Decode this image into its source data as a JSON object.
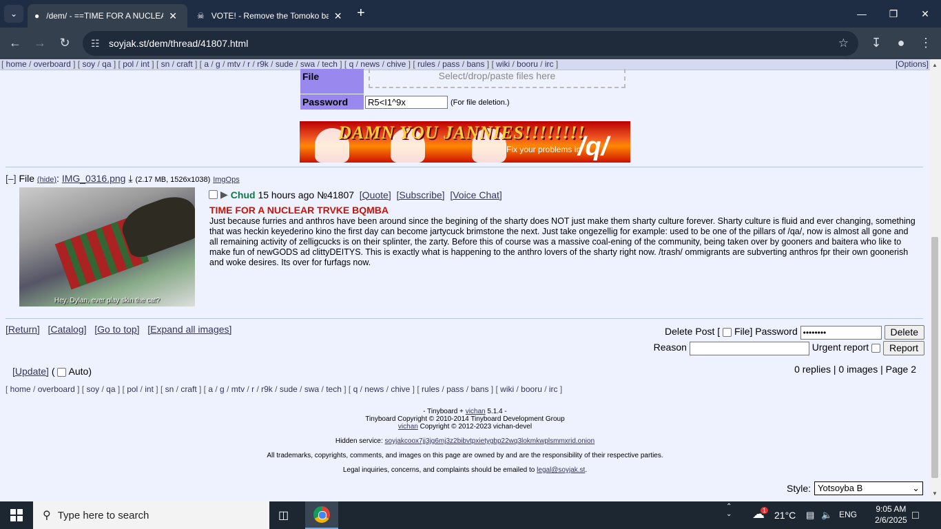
{
  "browser": {
    "tabs": [
      {
        "title": "/dem/ - ==TIME FOR A NUCLEAR TRVKE BQMBA",
        "active": true
      },
      {
        "title": "VOTE! - Remove the Tomoko ban",
        "active": false
      }
    ],
    "url": "soyjak.st/dem/thread/41807.html"
  },
  "topnav": {
    "groups": [
      [
        "home",
        "overboard"
      ],
      [
        "soy",
        "qa"
      ],
      [
        "pol",
        "int"
      ],
      [
        "sn",
        "craft"
      ],
      [
        "a",
        "g",
        "mtv",
        "r",
        "r9k",
        "sude",
        "swa",
        "tech"
      ],
      [
        "q",
        "news",
        "chive"
      ],
      [
        "rules",
        "pass",
        "bans"
      ],
      [
        "wiki",
        "booru",
        "irc"
      ]
    ],
    "options": "[Options]"
  },
  "postform": {
    "file_label": "File",
    "file_placeholder": "Select/drop/paste files here",
    "password_label": "Password",
    "password_value": "R5<I1^9x",
    "password_note": "(For file deletion.)"
  },
  "banner": {
    "headline": "DAMN YOU JANNIES!!!!!!!!",
    "subtext": "Fix your problems in",
    "board": "/q/"
  },
  "post": {
    "collapse": "[–]",
    "file_label": "File",
    "hide": "(hide)",
    "filename": "IMG_0316.png",
    "file_meta": "(2.17 MB, 1526x1038)",
    "imgops": "ImgOps",
    "image_caption": "Hey, Dylan, ever play skin the cat?",
    "name": "Chud",
    "time": "15 hours ago",
    "number": "№41807",
    "quote": "[Quote]",
    "subscribe": "[Subscribe]",
    "voice_chat": "[Voice Chat]",
    "subject": "TIME FOR A NUCLEAR TRVKE BQMBA",
    "body": "Just because furries and anthros have been around since the begining of the sharty does NOT just make them sharty culture forever. Sharty culture is fluid and ever changing, something that was heckin keyederino kino the first day can become jartycuck brimstone the next. Just take ongezellig for example: used to be one of the pillars of /qa/, now is almost all gone and all remaining activity of zelligcucks is on their splinter, the zarty. Before this of course was a massive coal-ening of the community, being taken over by gooners and baitera who like to make fun of newGODS ad clittyDEITYS. This is exactly what is happening to the anthro lovers of the sharty right now. /trash/ ommigrants are subverting anthros fpr their own goonerish and woke desires. Its over for furfags now."
  },
  "bottom_links": [
    "[Return]",
    "[Catalog]",
    "[Go to top]",
    "[Expand all images]"
  ],
  "delete_form": {
    "delete_post": "Delete Post [",
    "file": "File] Password",
    "password_value": "••••••••",
    "delete_btn": "Delete",
    "reason": "Reason",
    "urgent": "Urgent report",
    "report_btn": "Report"
  },
  "update": {
    "link": "[Update]",
    "open": "(",
    "auto": "Auto)"
  },
  "stats": "0 replies | 0 images | Page 2",
  "footer": {
    "line1": "- Tinyboard +",
    "vichan": "vichan",
    "version": "5.1.4 -",
    "line2": "Tinyboard Copyright © 2010-2014 Tinyboard Development Group",
    "line3_link": "vichan",
    "line3": "Copyright © 2012-2023 vichan-devel",
    "hidden_label": "Hidden service:",
    "hidden_onion": "soyjakcoox7jj3jg6mj3z2bibvtpxietygbp22wq3lokmkwplsmmxrid.onion",
    "trademarks": "All trademarks, copyrights, comments, and images on this page are owned by and are the responsibility of their respective parties.",
    "legal": "Legal inquiries, concerns, and complaints should be emailed to",
    "legal_email": "legal@soyjak.st",
    "legal_end": "."
  },
  "style_selector": {
    "label": "Style:",
    "value": "Yotsoyba B"
  },
  "taskbar": {
    "search_placeholder": "Type here to search",
    "weather": "21°C",
    "weather_badge": "1",
    "lang": "ENG",
    "time": "9:05 AM",
    "date": "2/6/2025"
  }
}
